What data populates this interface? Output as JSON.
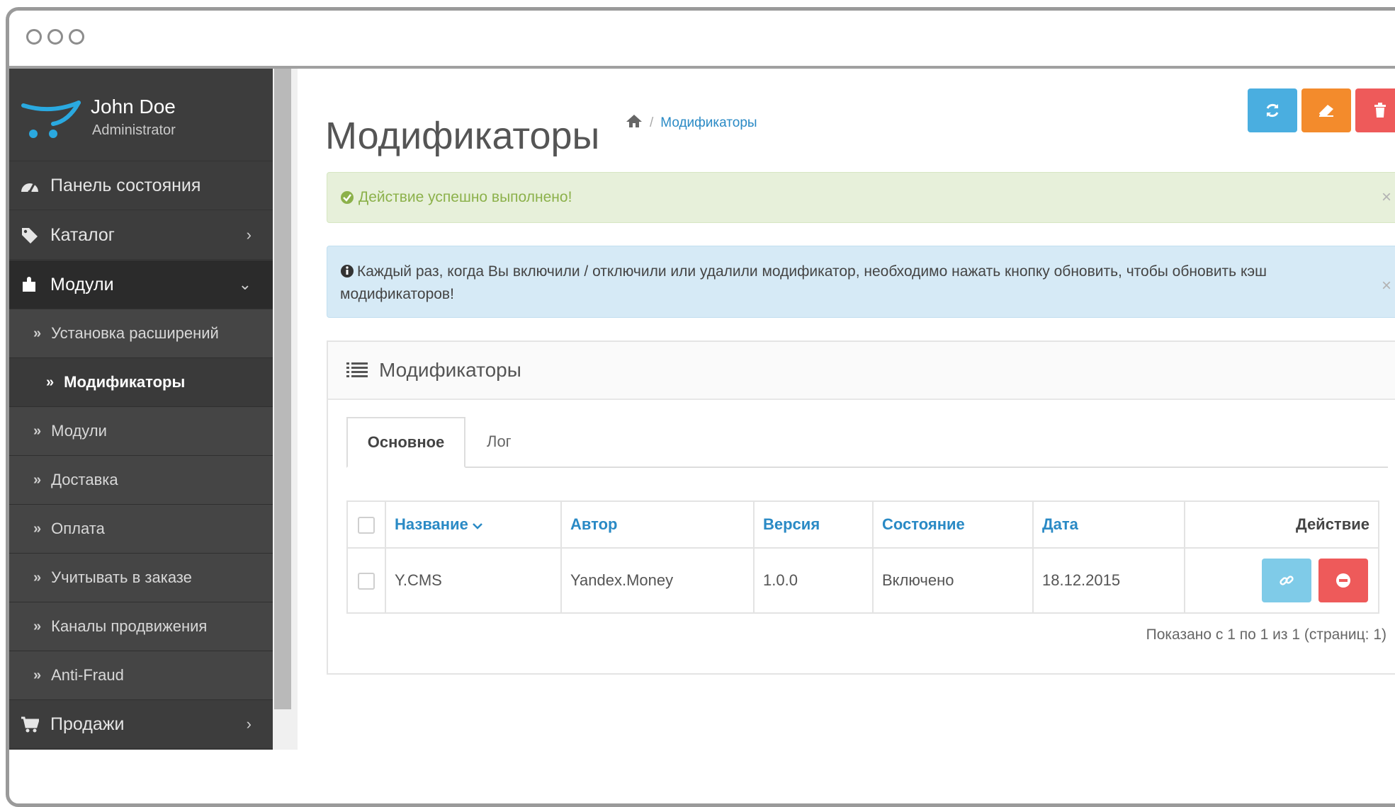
{
  "window": {
    "controls": [
      "window-dot",
      "window-dot",
      "window-dot"
    ]
  },
  "sidebar": {
    "user_name": "John Doe",
    "user_role": "Administrator",
    "items": [
      {
        "label": "Панель состояния",
        "icon": "dashboard-icon"
      },
      {
        "label": "Каталог",
        "icon": "tag-icon",
        "chevron": "›"
      },
      {
        "label": "Модули",
        "icon": "puzzle-icon",
        "chevron": "⌄"
      }
    ],
    "subitems": [
      {
        "label": "Установка расширений"
      },
      {
        "label": "Модификаторы"
      },
      {
        "label": "Модули"
      },
      {
        "label": "Доставка"
      },
      {
        "label": "Оплата"
      },
      {
        "label": "Учитывать в заказе"
      },
      {
        "label": "Каналы продвижения"
      },
      {
        "label": "Anti-Fraud"
      }
    ],
    "sales": {
      "label": "Продажи",
      "icon": "cart-icon",
      "chevron": "›"
    }
  },
  "header": {
    "title": "Модификаторы",
    "breadcrumb_sep": "/",
    "breadcrumb_current": "Модификаторы",
    "buttons": [
      {
        "icon": "refresh-icon",
        "color": "#4aaee0"
      },
      {
        "icon": "eraser-icon",
        "color": "#f38b2c"
      },
      {
        "icon": "trash-icon",
        "color": "#ee5a5a"
      }
    ]
  },
  "alerts": {
    "success_text": "Действие успешно выполнено!",
    "info_text": "Каждый раз, когда Вы включили / отключили или удалили модификатор, необходимо нажать кнопку обновить, чтобы обновить кэш модификаторов!",
    "close": "×"
  },
  "panel": {
    "title": "Модификаторы",
    "tabs": [
      {
        "label": "Основное"
      },
      {
        "label": "Лог"
      }
    ],
    "columns": {
      "name": "Название",
      "author": "Автор",
      "version": "Версия",
      "status": "Состояние",
      "date": "Дата",
      "action": "Действие"
    },
    "rows": [
      {
        "name": "Y.CMS",
        "author": "Yandex.Money",
        "version": "1.0.0",
        "status": "Включено",
        "date": "18.12.2015"
      }
    ],
    "pagination": "Показано с 1 по 1 из 1 (страниц: 1)"
  },
  "colors": {
    "link_blue": "#2a8ac5",
    "btn_blue_light": "#7fcbe8",
    "btn_red": "#ee5a5a",
    "success_green": "#8cb14b"
  }
}
